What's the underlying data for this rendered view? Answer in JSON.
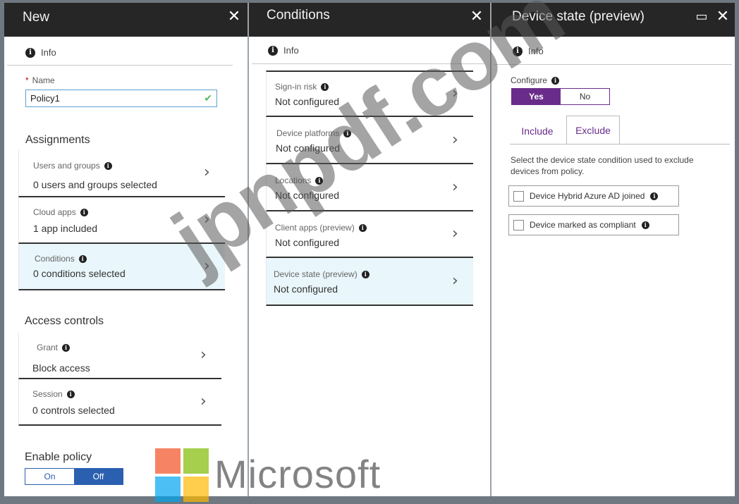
{
  "blades": {
    "new": {
      "title": "New",
      "info": "Info",
      "name_label": "Name",
      "name_value": "Policy1",
      "assignments_title": "Assignments",
      "assignments": [
        {
          "label": "Users and groups",
          "value": "0 users and groups selected"
        },
        {
          "label": "Cloud apps",
          "value": "1 app included"
        },
        {
          "label": "Conditions",
          "value": "0  conditions  selected"
        }
      ],
      "access_controls_title": "Access controls",
      "access_controls": [
        {
          "label": "Grant",
          "value": "Block access"
        },
        {
          "label": "Session",
          "value": "0 controls selected"
        }
      ],
      "enable_policy_label": "Enable policy",
      "toggle_on": "On",
      "toggle_off": "Off",
      "enable_policy_selected": "Off"
    },
    "conditions": {
      "title": "Conditions",
      "info": "Info",
      "items": [
        {
          "label": "Sign-in risk",
          "value": "Not configured"
        },
        {
          "label": "Device platforms",
          "value": "Not configured"
        },
        {
          "label": "Locations",
          "value": "Not configured"
        },
        {
          "label": "Client apps (preview)",
          "value": "Not configured"
        },
        {
          "label": "Device state (preview)",
          "value": "Not configured"
        }
      ]
    },
    "device_state": {
      "title": "Device state (preview)",
      "info": "Info",
      "configure_label": "Configure",
      "yes": "Yes",
      "no": "No",
      "configure_selected": "Yes",
      "tab_include": "Include",
      "tab_exclude": "Exclude",
      "active_tab": "Exclude",
      "description": "Select the device state condition used to exclude devices from policy.",
      "options": [
        {
          "label": "Device Hybrid Azure AD joined",
          "checked": false
        },
        {
          "label": "Device marked as compliant",
          "checked": false
        }
      ]
    }
  },
  "watermark": "jpnpdf.com",
  "brand": "Microsoft",
  "colors": {
    "header_bg": "#262626",
    "accent_blue": "#2b5fb0",
    "accent_purple": "#6a2c8a",
    "highlight": "#e9f6fb",
    "ms_red": "#f25022",
    "ms_green": "#7fba00",
    "ms_blue": "#00a4ef",
    "ms_yellow": "#ffb900"
  }
}
